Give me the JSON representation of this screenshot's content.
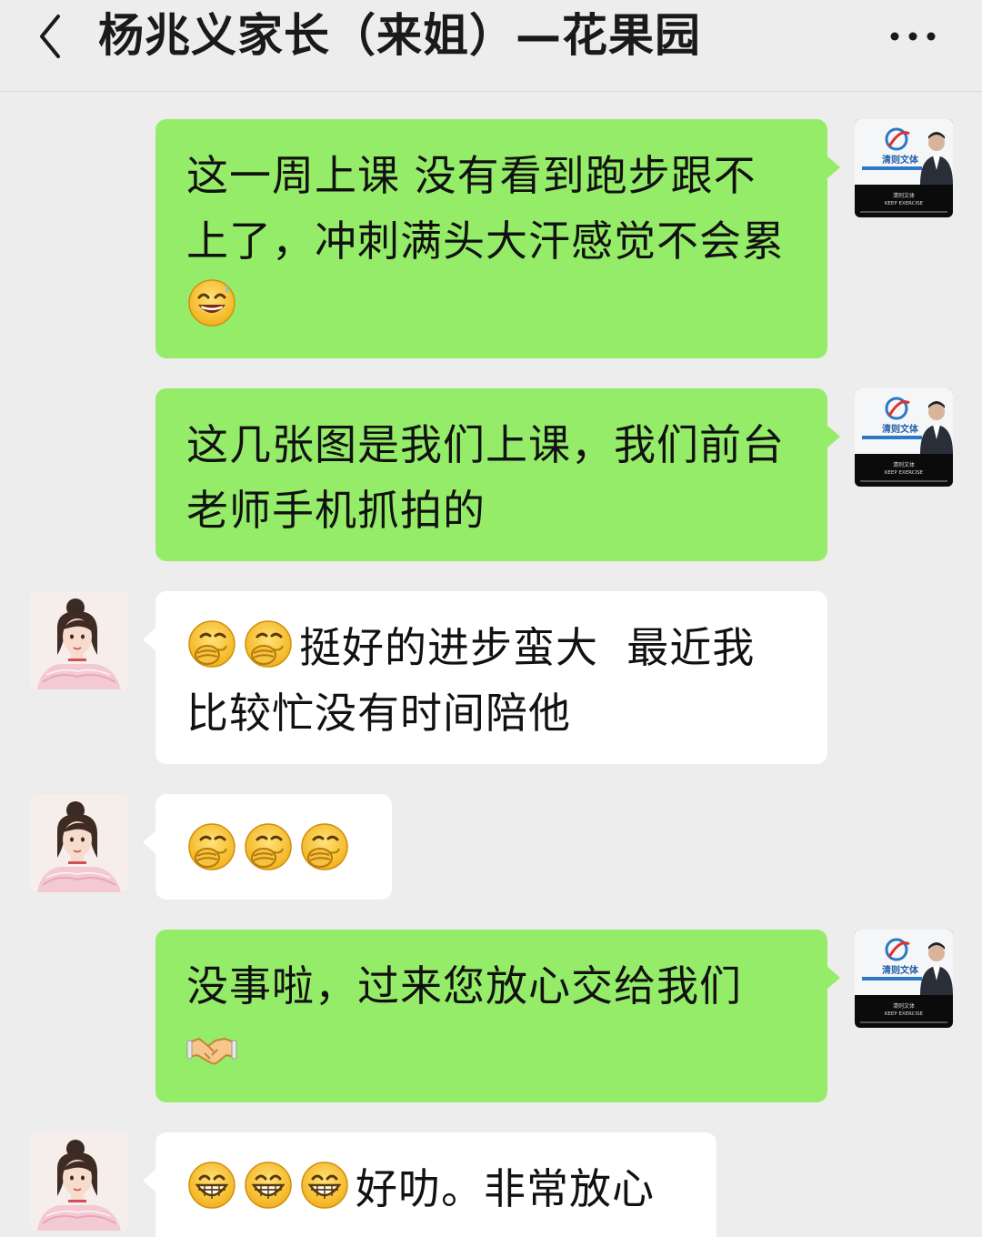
{
  "header": {
    "title": "杨兆义家长（来姐）—花果园",
    "back_icon": "chevron-left-icon",
    "more_icon": "more-dots-icon"
  },
  "colors": {
    "background": "#ededed",
    "outgoing_bubble": "#95ec69",
    "incoming_bubble": "#ffffff"
  },
  "self_avatar": {
    "brand_text": "清则文体",
    "slogan": "KEEP EXERCISE"
  },
  "messages": [
    {
      "side": "outgoing",
      "text": "这一周上课 没有看到跑步跟不上了，冲刺满头大汗感觉不会累",
      "trailing_emoji": "grinning-sweat-emoji"
    },
    {
      "side": "outgoing",
      "text": "这几张图是我们上课，我们前台老师手机抓拍的"
    },
    {
      "side": "incoming",
      "leading_emoji": [
        "hand-over-mouth-emoji",
        "hand-over-mouth-emoji"
      ],
      "text": "挺好的进步蛮大  最近我比较忙没有时间陪他"
    },
    {
      "side": "incoming",
      "emoji_only": [
        "hand-over-mouth-emoji",
        "hand-over-mouth-emoji",
        "hand-over-mouth-emoji"
      ]
    },
    {
      "side": "outgoing",
      "text": "没事啦，过来您放心交给我们",
      "trailing_emoji": "handshake-emoji"
    },
    {
      "side": "incoming",
      "leading_emoji": [
        "grinning-emoji",
        "grinning-emoji",
        "grinning-emoji"
      ],
      "text": "好叻。非常放心"
    }
  ]
}
